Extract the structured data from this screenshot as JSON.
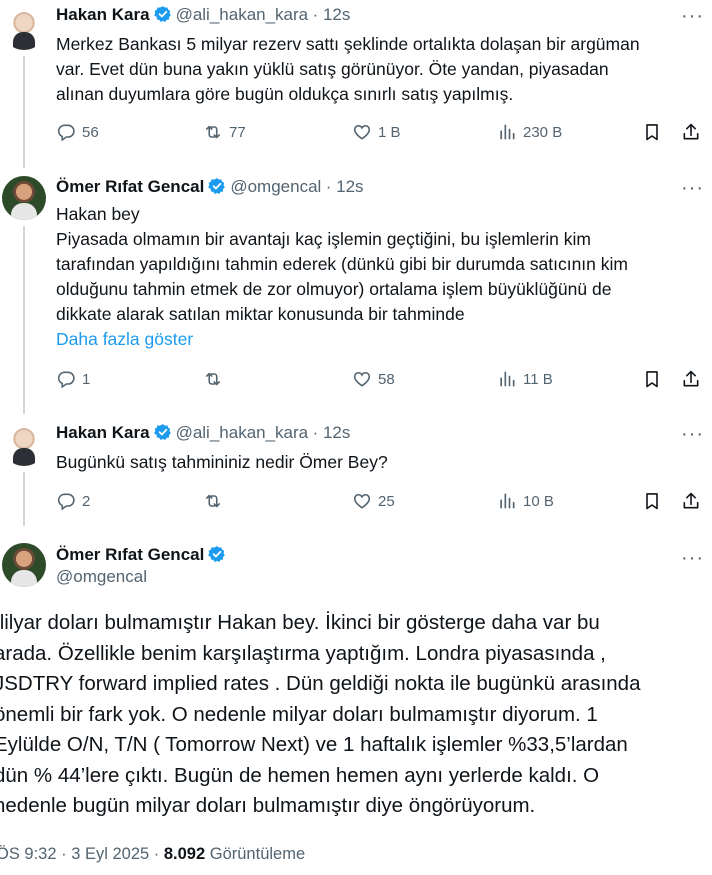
{
  "tweets": [
    {
      "name": "Hakan Kara",
      "handle": "@ali_hakan_kara",
      "time": "· 12s",
      "lines": [
        "Merkez Bankası 5 milyar rezerv sattı şeklinde ortalıkta dolaşan bir argüman",
        "var. Evet dün buna yakın yüklü satış görünüyor. Öte yandan, piyasadan",
        "alınan duyumlara göre bugün oldukça sınırlı satış yapılmış."
      ],
      "replies": "56",
      "reposts": "77",
      "likes": "1 B",
      "views": "230 B"
    },
    {
      "name": "Ömer Rıfat Gencal",
      "handle": "@omgencal",
      "time": "· 12s",
      "lines": [
        "Hakan bey",
        "Piyasada olmamın bir avantajı kaç işlemin geçtiğini, bu işlemlerin kim",
        "tarafından yapıldığını tahmin ederek (dünkü gibi bir durumda satıcının kim",
        "olduğunu tahmin etmek de zor olmuyor) ortalama işlem büyüklüğünü de",
        "dikkate alarak satılan miktar konusunda bir tahminde"
      ],
      "show_more": "Daha fazla göster",
      "replies": "1",
      "reposts": "",
      "likes": "58",
      "views": "11 B"
    },
    {
      "name": "Hakan Kara",
      "handle": "@ali_hakan_kara",
      "time": "· 12s",
      "lines": [
        "Bugünkü satış tahmininiz nedir Ömer Bey?"
      ],
      "replies": "2",
      "reposts": "",
      "likes": "25",
      "views": "10 B"
    }
  ],
  "main_tweet": {
    "name": "Ömer Rıfat Gencal",
    "handle": "@omgencal",
    "lines": [
      "/lilyar doları bulmamıştır Hakan bey. İkinci bir gösterge daha var bu",
      "arada. Özellikle benim karşılaştırma yaptığım. Londra piyasasında ,",
      "JSDTRY forward implied rates . Dün geldiği nokta ile bugünkü arasında",
      "önemli bir fark yok. O nedenle milyar doları bulmamıştır diyorum. 1",
      "Eylülde O/N, T/N ( Tomorrow Next) ve 1 haftalık işlemler %33,5’lardan",
      "dün % 44’lere çıktı. Bugün de hemen hemen aynı yerlerde kaldı. O",
      "nedenle bugün milyar doları bulmamıştır diye öngörüyorum."
    ],
    "timestamp": "ÖS 9:32 · 3 Eyl 2025 ·",
    "view_count": "8.092",
    "view_label": "Görüntüleme"
  },
  "colors": {
    "verified": "#1d9bf0",
    "link": "#1d9bf0",
    "muted": "#536471",
    "text": "#0f1419"
  },
  "icons": [
    "reply-icon",
    "repost-icon",
    "like-icon",
    "views-icon",
    "bookmark-icon",
    "share-icon",
    "verified-badge-icon",
    "more-icon"
  ]
}
